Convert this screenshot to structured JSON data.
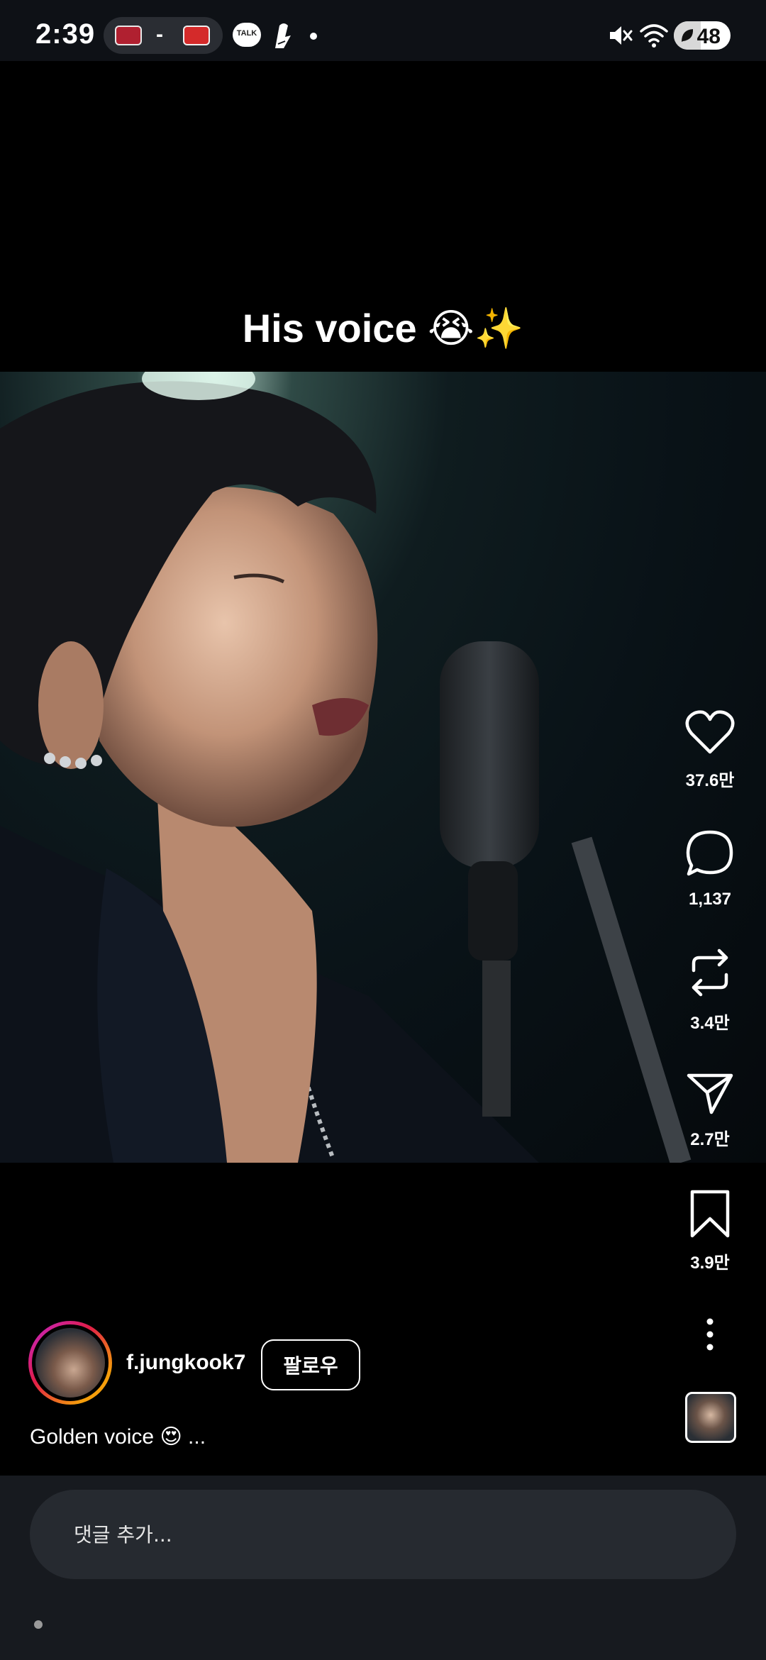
{
  "status_bar": {
    "time": "2:39",
    "score_separator": "-",
    "talk_label": "TALK",
    "battery_level": "48",
    "battery_percent": 48
  },
  "reel": {
    "caption": "His voice 😭✨"
  },
  "actions": {
    "like_count": "37.6만",
    "comment_count": "1,137",
    "repost_count": "3.4만",
    "share_count": "2.7만",
    "save_count": "3.9만"
  },
  "author": {
    "username": "f.jungkook7",
    "follow_label": "팔로우",
    "description": "Golden voice 😍 ..."
  },
  "comment_box": {
    "placeholder": "댓글 추가..."
  },
  "icons": {
    "like": "heart-icon",
    "comment": "speech-bubble-icon",
    "repost": "repost-icon",
    "share": "paper-plane-icon",
    "save": "bookmark-icon",
    "more": "more-vertical-icon"
  },
  "colors": {
    "status_bar_bg": "#0e1116",
    "bottom_bar_bg": "#171a1f",
    "input_bg": "#262a30"
  }
}
